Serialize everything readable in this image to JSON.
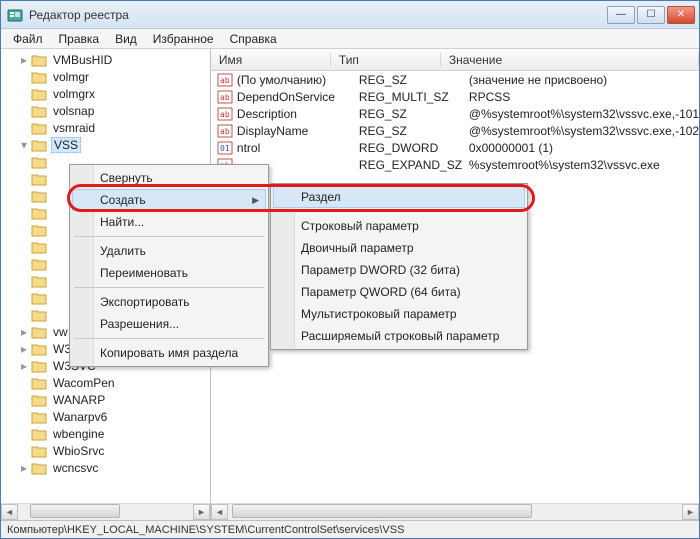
{
  "window": {
    "title": "Редактор реестра"
  },
  "menu": {
    "file": "Файл",
    "edit": "Правка",
    "view": "Вид",
    "favorites": "Избранное",
    "help": "Справка"
  },
  "tree": {
    "items": [
      {
        "label": "VMBusHID",
        "expand": "+"
      },
      {
        "label": "volmgr",
        "expand": ""
      },
      {
        "label": "volmgrx",
        "expand": ""
      },
      {
        "label": "volsnap",
        "expand": ""
      },
      {
        "label": "vsmraid",
        "expand": ""
      },
      {
        "label": "VSS",
        "expand": "▾",
        "selected": true
      },
      {
        "label": "",
        "expand": ""
      },
      {
        "label": "",
        "expand": ""
      },
      {
        "label": "",
        "expand": ""
      },
      {
        "label": "",
        "expand": ""
      },
      {
        "label": "",
        "expand": ""
      },
      {
        "label": "",
        "expand": ""
      },
      {
        "label": "",
        "expand": ""
      },
      {
        "label": "",
        "expand": ""
      },
      {
        "label": "",
        "expand": ""
      },
      {
        "label": "",
        "expand": ""
      },
      {
        "label": "vw",
        "expand": "+"
      },
      {
        "label": "W32Time",
        "expand": "+"
      },
      {
        "label": "W3SVC",
        "expand": "+"
      },
      {
        "label": "WacomPen",
        "expand": ""
      },
      {
        "label": "WANARP",
        "expand": ""
      },
      {
        "label": "Wanarpv6",
        "expand": ""
      },
      {
        "label": "wbengine",
        "expand": ""
      },
      {
        "label": "WbioSrvc",
        "expand": ""
      },
      {
        "label": "wcncsvc",
        "expand": "+"
      }
    ]
  },
  "list": {
    "columns": {
      "name": "Имя",
      "type": "Тип",
      "value": "Значение"
    },
    "rows": [
      {
        "name": "(По умолчанию)",
        "type": "REG_SZ",
        "value": "(значение не присвоено)",
        "icon": "str"
      },
      {
        "name": "DependOnService",
        "type": "REG_MULTI_SZ",
        "value": "RPCSS",
        "icon": "str"
      },
      {
        "name": "Description",
        "type": "REG_SZ",
        "value": "@%systemroot%\\system32\\vssvc.exe,-101",
        "icon": "str"
      },
      {
        "name": "DisplayName",
        "type": "REG_SZ",
        "value": "@%systemroot%\\system32\\vssvc.exe,-102",
        "icon": "str"
      },
      {
        "name": "ntrol",
        "type": "REG_DWORD",
        "value": "0x00000001 (1)",
        "icon": "bin"
      },
      {
        "name": "",
        "type": "REG_EXPAND_SZ",
        "value": "%systemroot%\\system32\\vssvc.exe",
        "icon": "str"
      }
    ]
  },
  "context_main": {
    "items": [
      {
        "label": "Свернуть"
      },
      {
        "label": "Создать",
        "submenu": true,
        "hov": true
      },
      {
        "label": "Найти..."
      },
      {
        "sep": true
      },
      {
        "label": "Удалить"
      },
      {
        "label": "Переименовать"
      },
      {
        "sep": true
      },
      {
        "label": "Экспортировать"
      },
      {
        "label": "Разрешения..."
      },
      {
        "sep": true
      },
      {
        "label": "Копировать имя раздела"
      }
    ]
  },
  "context_sub": {
    "items": [
      {
        "label": "Раздел",
        "hov": true
      },
      {
        "sep": true
      },
      {
        "label": "Строковый параметр"
      },
      {
        "label": "Двоичный параметр"
      },
      {
        "label": "Параметр DWORD (32 бита)"
      },
      {
        "label": "Параметр QWORD (64 бита)"
      },
      {
        "label": "Мультистроковый параметр"
      },
      {
        "label": "Расширяемый строковый параметр"
      }
    ]
  },
  "status": {
    "path": "Компьютер\\HKEY_LOCAL_MACHINE\\SYSTEM\\CurrentControlSet\\services\\VSS"
  }
}
